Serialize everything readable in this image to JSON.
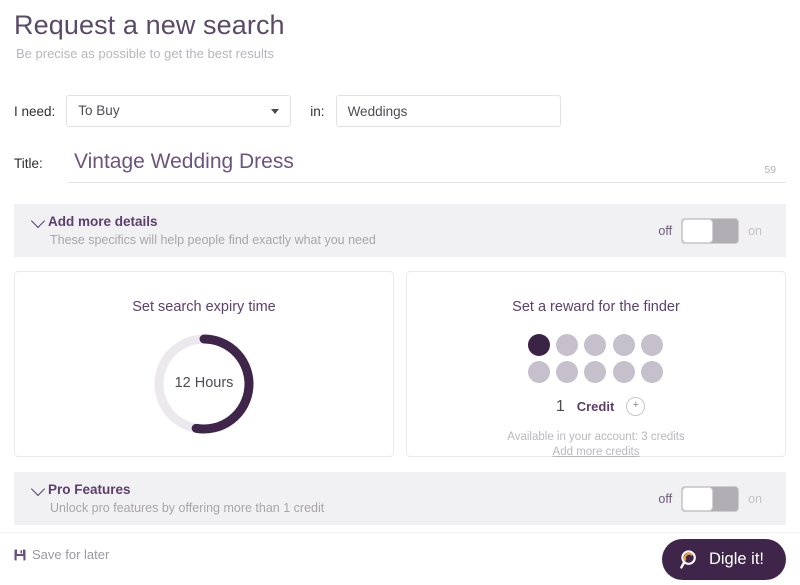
{
  "header": {
    "title": "Request a new search",
    "subtitle": "Be precise as possible to get the best results"
  },
  "form": {
    "need_label": "I need:",
    "need_value": "To Buy",
    "need_options": [
      "To Buy"
    ],
    "in_label": "in:",
    "in_value": "Weddings",
    "in_placeholder": "Weddings",
    "title_label": "Title:",
    "title_value": "Vintage Wedding Dress",
    "title_char_count": "59"
  },
  "details_section": {
    "heading": "Add more details",
    "subtext": "These specifics will help people find exactly what you need",
    "toggle_off_label": "off",
    "toggle_on_label": "on",
    "toggle_state": "off"
  },
  "expiry_card": {
    "title": "Set search expiry time",
    "value_label": "12 Hours",
    "arc_degrees": 190,
    "track_color": "#ece9ee",
    "arc_color": "#3e2549"
  },
  "reward_card": {
    "title": "Set a reward for the finder",
    "dots_total": 10,
    "dots_filled": 1,
    "credit_count": "1",
    "credit_word": "Credit",
    "plus_label": "+",
    "available_text": "Available in your account: 3 credits",
    "add_credits_link": "Add more credits"
  },
  "pro_section": {
    "heading": "Pro Features",
    "subtext": "Unlock pro features by offering more than 1 credit",
    "toggle_off_label": "off",
    "toggle_on_label": "on",
    "toggle_state": "off"
  },
  "footer": {
    "save_label": "Save for later",
    "submit_label": "Digle it!"
  },
  "colors": {
    "brand_purple": "#3e2549",
    "heading_purple": "#5c3f6e",
    "muted_gray": "#b9b5bd",
    "band_bg": "#f1f0f2",
    "accent_orange": "#e8a33d"
  }
}
